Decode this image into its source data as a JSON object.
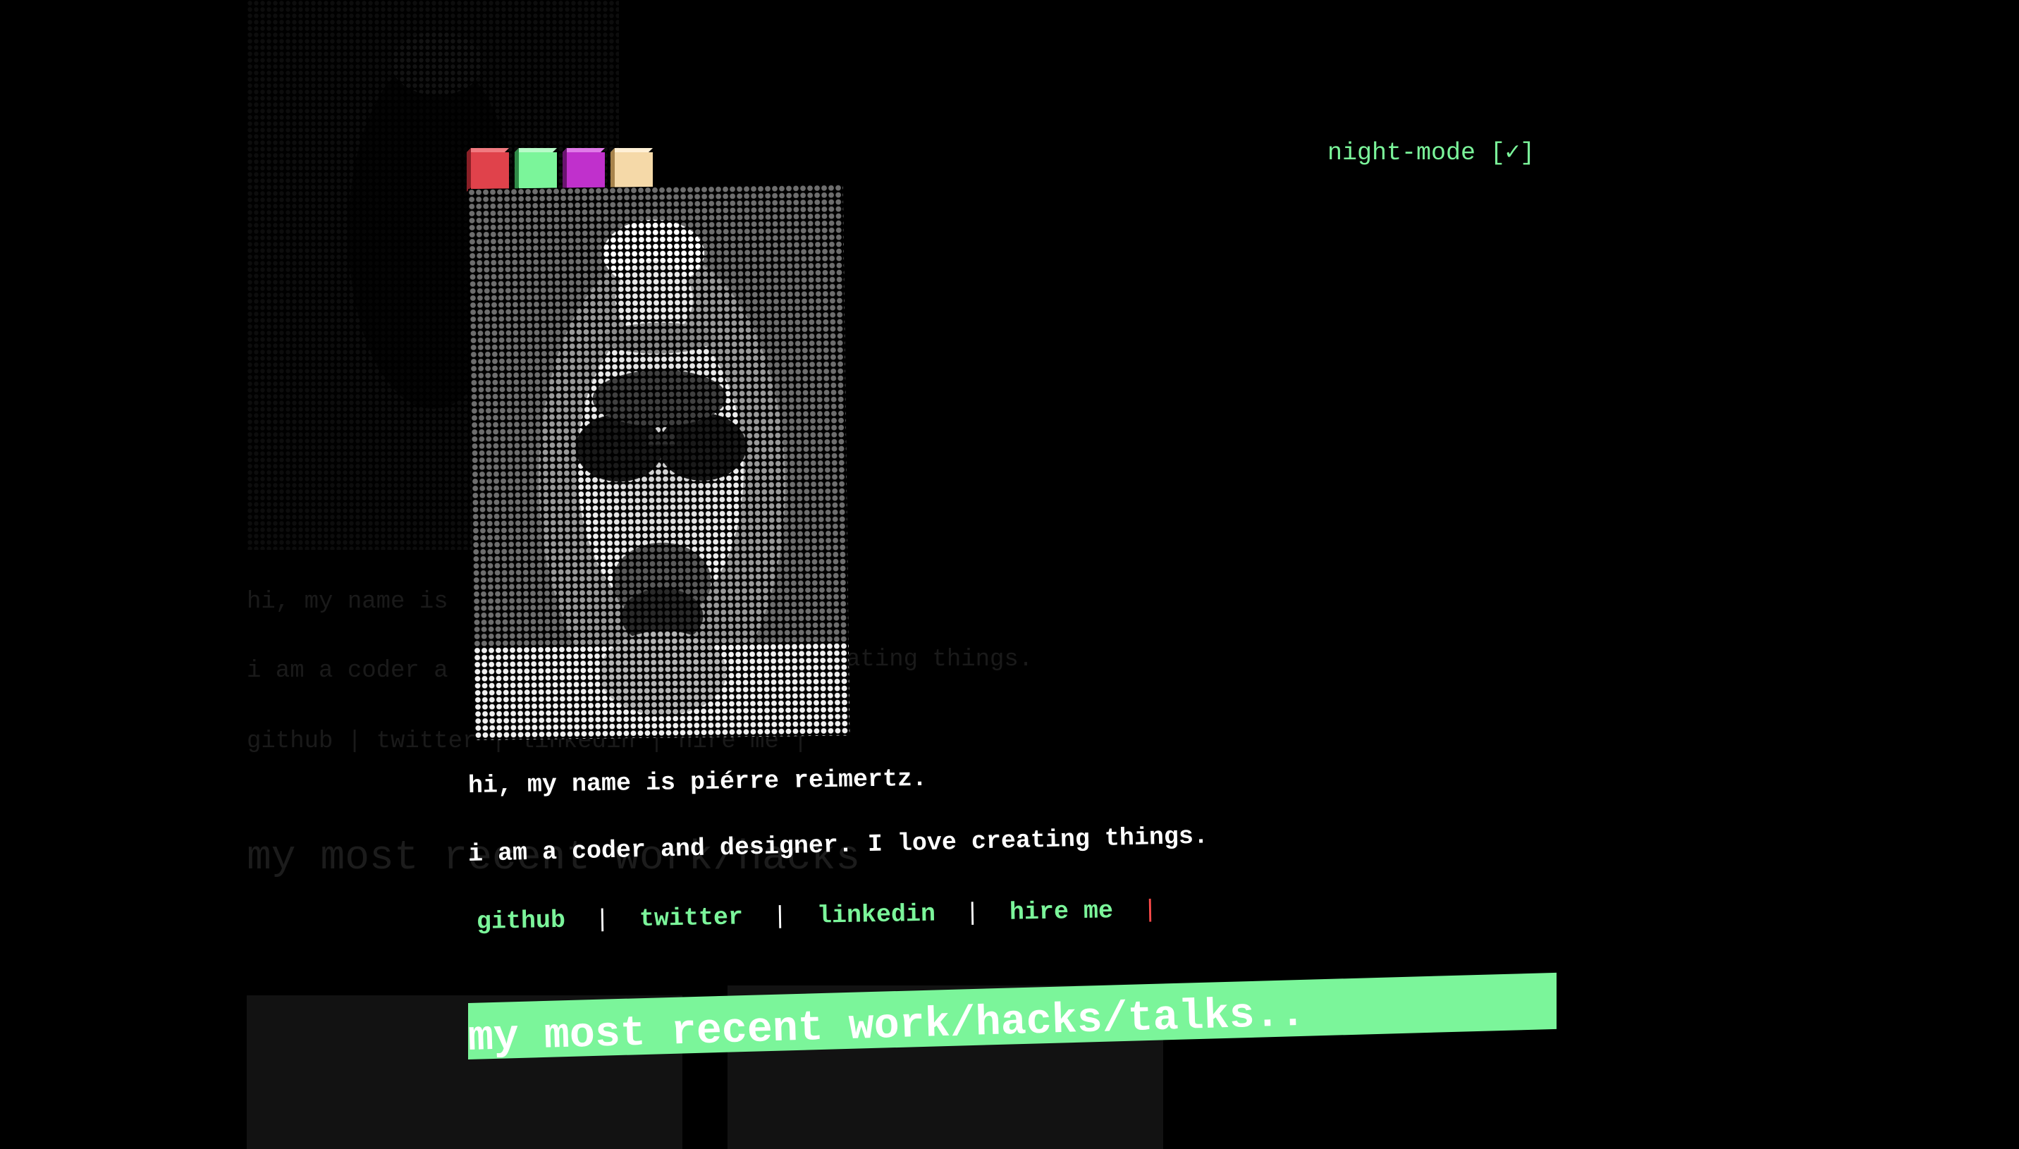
{
  "theme": {
    "background": "#000000",
    "accent": "#7bf59a",
    "text": "#ffffff",
    "cursor": "#ff4a4a"
  },
  "night_mode": {
    "label": "night-mode [✓]",
    "enabled": true
  },
  "swatches": [
    {
      "name": "red",
      "color": "#e0424b"
    },
    {
      "name": "green",
      "color": "#7bf59a"
    },
    {
      "name": "purple",
      "color": "#c030cc"
    },
    {
      "name": "cream",
      "color": "#f5d9a8"
    }
  ],
  "intro": {
    "line1": "hi, my name is piérre reimertz.",
    "line2": "i am a coder and designer. I love creating things."
  },
  "links": [
    {
      "label": "github"
    },
    {
      "label": "twitter"
    },
    {
      "label": "linkedin"
    },
    {
      "label": "hire me"
    }
  ],
  "link_separator": "|",
  "cursor_char": "|",
  "section_heading": "my most recent work/hacks/talks..",
  "ghost": {
    "line1": "hi, my name is",
    "line2_left": "i am a coder a",
    "line2_right": "ating things.",
    "links_line": "github | twitter | linkedin | hire me |",
    "heading": "my most recent work/hacks"
  }
}
